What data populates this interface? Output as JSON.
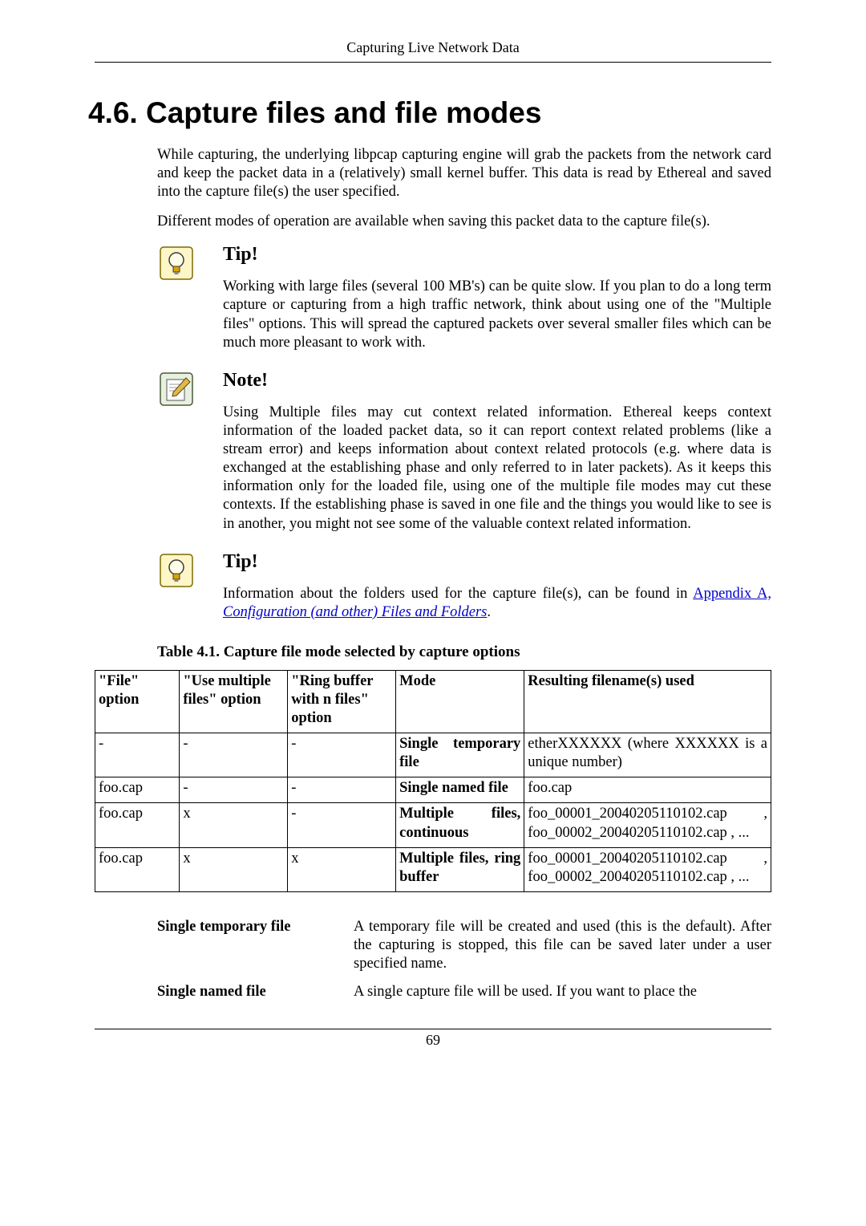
{
  "header": {
    "running": "Capturing Live Network Data",
    "title": "4.6. Capture files and file modes",
    "page_number": "69"
  },
  "paragraphs": {
    "p1": "While capturing, the underlying libpcap capturing engine will grab the packets from the network card and keep the packet data in a (relatively) small kernel buffer. This data is read by Ethereal and saved into the capture file(s) the user specified.",
    "p2": "Different modes of operation are available when saving this packet data to the capture file(s)."
  },
  "tip1": {
    "heading": "Tip!",
    "text": "Working with large files (several 100 MB's) can be quite slow. If you plan to do a long term capture or capturing from a high traffic network, think about using one of the \"Multiple files\" options. This will spread the captured packets over several smaller files which can be much more pleasant to work with."
  },
  "note1": {
    "heading": "Note!",
    "text": "Using Multiple files may cut context related information. Ethereal keeps context information of the loaded packet data, so it can report context related problems (like a stream error) and keeps information about context related protocols (e.g. where data is exchanged at the establishing phase and only referred to in later packets). As it keeps this information only for the loaded file, using one of the multiple file modes may cut these contexts. If the establishing phase is saved in one file and the things you would like to see is in another, you might not see some of the valuable context related information."
  },
  "tip2": {
    "heading": "Tip!",
    "text_prefix": "Information about the folders used for the capture file(s), can be found in ",
    "link_part1": "Appendix A,",
    "link_part2": "Configuration (and other) Files and Folders",
    "text_suffix": "."
  },
  "table": {
    "caption": "Table 4.1. Capture file mode selected by capture options",
    "headers": {
      "h1": "\"File\" option",
      "h2": "\"Use multiple files\" option",
      "h3": "\"Ring buffer with n files\" option",
      "h4": "Mode",
      "h5": "Resulting filename(s) used"
    },
    "rows": [
      {
        "c1": "-",
        "c2": "-",
        "c3": "-",
        "c4": "Single temporary file",
        "c5": "etherXXXXXX (where XXXXXX is a unique number)"
      },
      {
        "c1": "foo.cap",
        "c2": "-",
        "c3": "-",
        "c4": "Single named file",
        "c5": "foo.cap"
      },
      {
        "c1": "foo.cap",
        "c2": "x",
        "c3": "-",
        "c4": "Multiple files, continuous",
        "c5": "foo_00001_20040205110102.cap , foo_00002_20040205110102.cap , ..."
      },
      {
        "c1": "foo.cap",
        "c2": "x",
        "c3": "x",
        "c4": "Multiple files, ring buffer",
        "c5": "foo_00001_20040205110102.cap , foo_00002_20040205110102.cap , ..."
      }
    ]
  },
  "defs": {
    "d1": {
      "term": "Single temporary file",
      "desc": "A temporary file will be created and used (this is the default). After the capturing is stopped, this file can be saved later under a user specified name."
    },
    "d2": {
      "term": "Single named file",
      "desc": "A single capture file will be used. If you want to place the"
    }
  }
}
